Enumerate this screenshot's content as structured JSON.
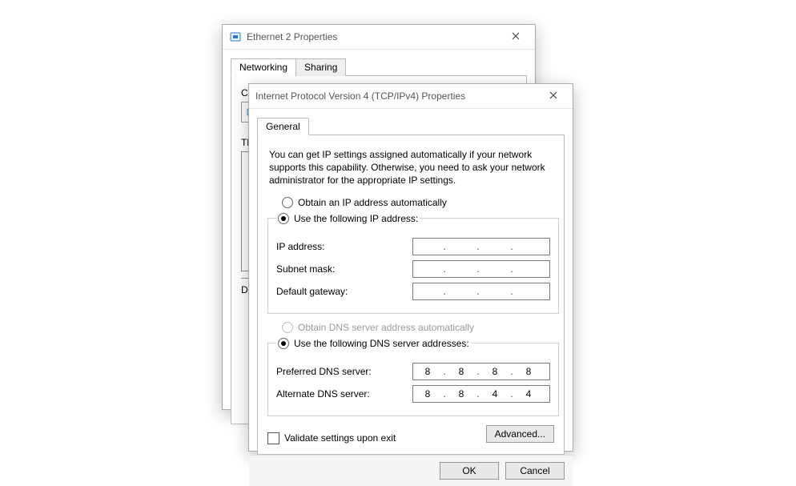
{
  "back": {
    "title": "Ethernet 2 Properties",
    "tabs": {
      "networking": "Networking",
      "sharing": "Sharing"
    },
    "connect_label_prefix": "Co",
    "this_list_prefix": "Th",
    "desc_prefix": "D"
  },
  "front": {
    "title": "Internet Protocol Version 4 (TCP/IPv4) Properties",
    "tab_general": "General",
    "description": "You can get IP settings assigned automatically if your network supports this capability. Otherwise, you need to ask your network administrator for the appropriate IP settings.",
    "ip": {
      "radio_auto": "Obtain an IP address automatically",
      "radio_manual": "Use the following IP address:",
      "lbl_ip": "IP address:",
      "lbl_mask": "Subnet mask:",
      "lbl_gw": "Default gateway:",
      "val_ip": [
        "",
        "",
        "",
        ""
      ],
      "val_mask": [
        "",
        "",
        "",
        ""
      ],
      "val_gw": [
        "",
        "",
        "",
        ""
      ]
    },
    "dns": {
      "radio_auto": "Obtain DNS server address automatically",
      "radio_manual": "Use the following DNS server addresses:",
      "lbl_pref": "Preferred DNS server:",
      "lbl_alt": "Alternate DNS server:",
      "val_pref": [
        "8",
        "8",
        "8",
        "8"
      ],
      "val_alt": [
        "8",
        "8",
        "4",
        "4"
      ]
    },
    "validate": "Validate settings upon exit",
    "advanced": "Advanced...",
    "ok": "OK",
    "cancel": "Cancel"
  }
}
